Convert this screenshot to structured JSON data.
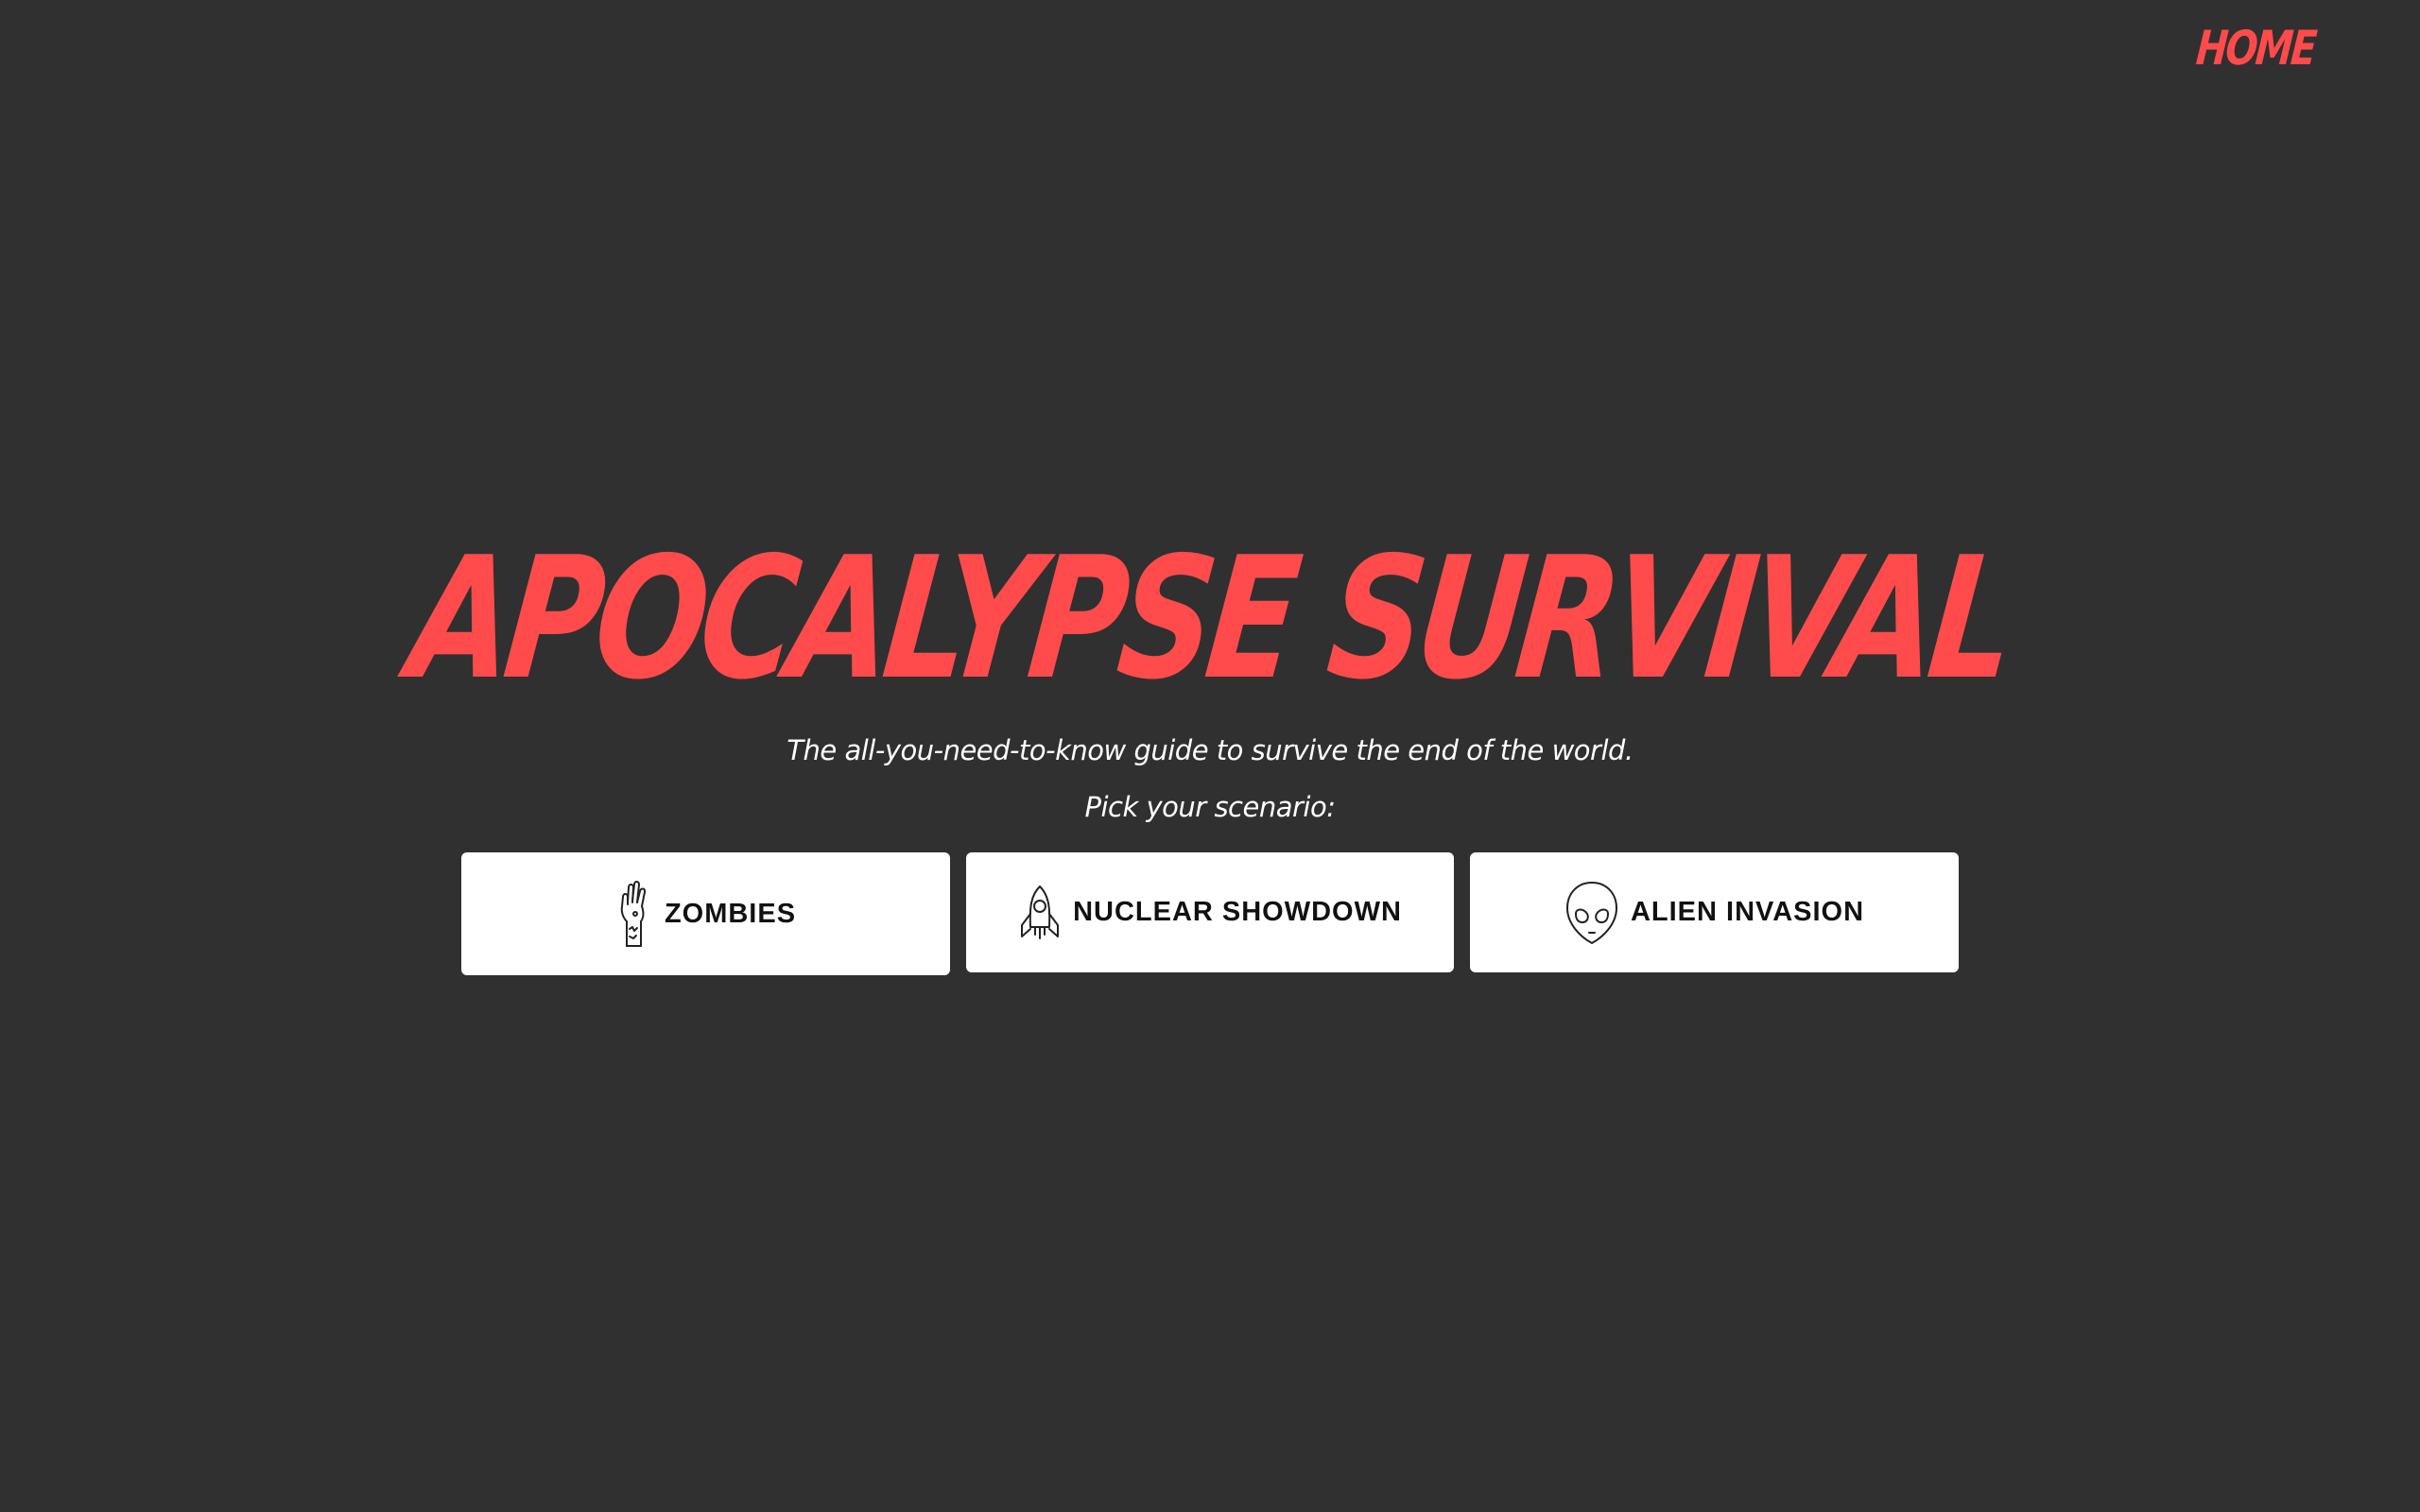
{
  "nav": {
    "home_label": "HOME"
  },
  "hero": {
    "title": "APOCALYPSE SURVIVAL",
    "tagline": "The all-you-need-to-know guide to survive the end of the world.",
    "pick_label": "Pick your scenario:"
  },
  "scenarios": [
    {
      "label": "ZOMBIES",
      "icon": "zombie-hand-icon"
    },
    {
      "label": "NUCLEAR SHOWDOWN",
      "icon": "rocket-icon"
    },
    {
      "label": "ALIEN INVASION",
      "icon": "alien-head-icon"
    }
  ],
  "colors": {
    "background": "#303030",
    "accent": "#ff4b4b",
    "text": "#ffffff",
    "button_bg": "#ffffff",
    "button_text": "#111111"
  }
}
